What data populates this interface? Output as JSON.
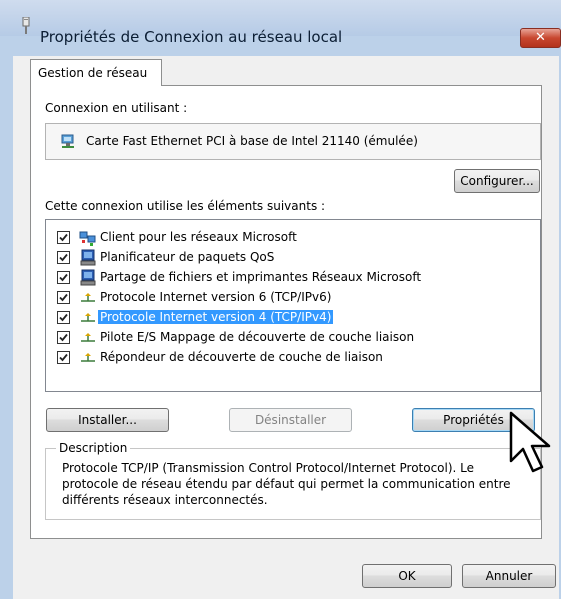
{
  "window": {
    "title": "Propriétés de Connexion au réseau local",
    "close_glyph": "✕"
  },
  "tabs": [
    {
      "label": "Gestion de réseau",
      "active": true
    }
  ],
  "connection": {
    "label": "Connexion en utilisant :",
    "adapter_name": "Carte Fast Ethernet PCI à base de Intel 21140 (émulée)",
    "adapter_icon": "network-adapter-icon",
    "configure_label": "Configurer..."
  },
  "components": {
    "label": "Cette connexion utilise les éléments suivants :",
    "items": [
      {
        "label": "Client pour les réseaux Microsoft",
        "checked": true,
        "icon": "network-client-icon",
        "selected": false
      },
      {
        "label": "Planificateur de paquets QoS",
        "checked": true,
        "icon": "service-icon",
        "selected": false
      },
      {
        "label": "Partage de fichiers et imprimantes Réseaux Microsoft",
        "checked": true,
        "icon": "service-icon",
        "selected": false
      },
      {
        "label": "Protocole Internet version 6 (TCP/IPv6)",
        "checked": true,
        "icon": "protocol-icon",
        "selected": false
      },
      {
        "label": "Protocole Internet version 4 (TCP/IPv4)",
        "checked": true,
        "icon": "protocol-icon",
        "selected": true
      },
      {
        "label": "Pilote E/S Mappage de découverte de couche liaison",
        "checked": true,
        "icon": "protocol-icon",
        "selected": false
      },
      {
        "label": "Répondeur de découverte de couche de liaison",
        "checked": true,
        "icon": "protocol-icon",
        "selected": false
      }
    ]
  },
  "actions": {
    "install_label": "Installer...",
    "uninstall_label": "Désinstaller",
    "properties_label": "Propriétés"
  },
  "description": {
    "legend": "Description",
    "text": "Protocole TCP/IP (Transmission Control Protocol/Internet Protocol). Le protocole de réseau étendu par défaut qui permet la communication entre différents réseaux interconnectés."
  },
  "footer": {
    "ok_label": "OK",
    "cancel_label": "Annuler"
  },
  "colors": {
    "selection": "#3399ff",
    "title_bar": "#bcd1e9",
    "close_button": "#c8472f",
    "dialog_background": "#f0f0f0"
  }
}
